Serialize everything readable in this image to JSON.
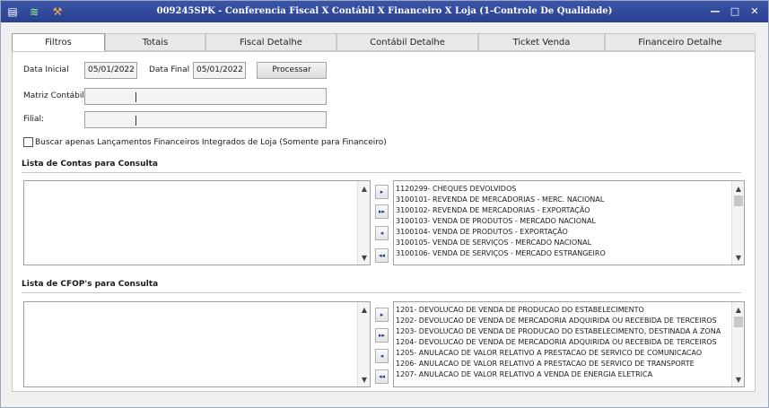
{
  "window": {
    "title": "009245SPK - Conferencia Fiscal X Contábil X Financeiro X Loja (1-Controle De Qualidade)",
    "min": "—",
    "max": "□",
    "close": "✕"
  },
  "tabs": [
    "Filtros",
    "Totais",
    "Fiscal Detalhe",
    "Contábil Detalhe",
    "Ticket Venda",
    "Financeiro Detalhe"
  ],
  "filters": {
    "data_inicial_label": "Data Inicial",
    "data_inicial": "05/01/2022",
    "data_final_label": "Data Final",
    "data_final": "05/01/2022",
    "processar": "Processar",
    "matriz_label": "Matriz Contábil:",
    "filial_label": "Filial:",
    "checkbox_label": "Buscar apenas Lançamentos Financeiros Integrados de Loja (Somente para Financeiro)"
  },
  "contas": {
    "title": "Lista de Contas para Consulta",
    "items": [
      "1120299- CHEQUES DEVOLVIDOS",
      "3100101- REVENDA DE MERCADORIAS - MERC. NACIONAL",
      "3100102- REVENDA DE MERCADORIAS - EXPORTAÇÃO",
      "3100103- VENDA DE PRODUTOS - MERCADO NACIONAL",
      "3100104- VENDA DE PRODUTOS - EXPORTAÇÃO",
      "3100105- VENDA DE SERVIÇOS - MERCADO NACIONAL",
      "3100106- VENDA DE SERVIÇOS - MERCADO ESTRANGEIRO"
    ]
  },
  "cfop": {
    "title": "Lista de CFOP's para Consulta",
    "items": [
      "1201- DEVOLUCAO DE VENDA DE PRODUCAO DO ESTABELECIMENTO",
      "1202- DEVOLUCAO DE VENDA DE MERCADORIA ADQUIRIDA OU RECEBIDA DE TERCEIROS",
      "1203- DEVOLUCAO DE VENDA DE PRODUCAO DO ESTABELECIMENTO, DESTINADA A ZONA",
      "1204- DEVOLUCAO DE VENDA DE MERCADORIA ADQUIRIDA OU RECEBIDA DE TERCEIROS",
      "1205- ANULACAO DE VALOR RELATIVO A PRESTACAO DE SERVICO DE COMUNICACAO",
      "1206- ANULACAO DE VALOR RELATIVO A PRESTACAO DE SERVICO DE TRANSPORTE",
      "1207- ANULACAO DE VALOR RELATIVO A VENDA DE ENERGIA ELETRICA"
    ]
  },
  "move_buttons": {
    "add_one": "▸",
    "add_all": "▸▸",
    "remove_one": "◂",
    "remove_all": "◂◂"
  },
  "scroll": {
    "up": "▲",
    "down": "▼"
  }
}
